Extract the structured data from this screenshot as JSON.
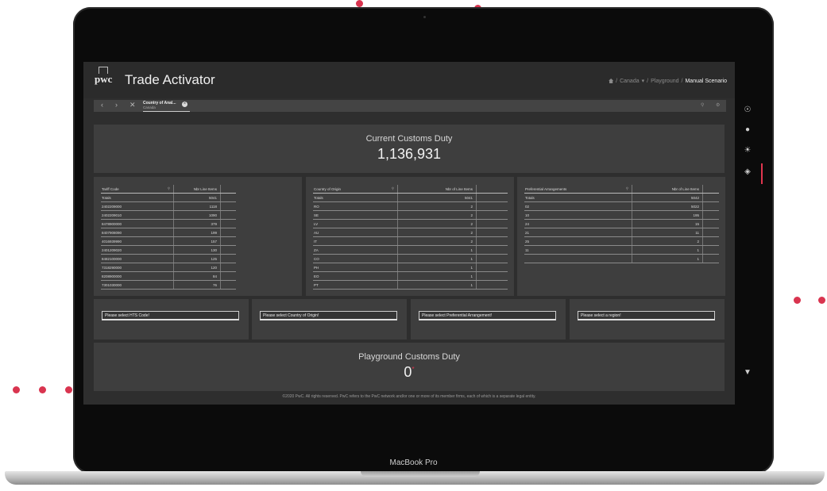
{
  "device": {
    "label": "MacBook Pro"
  },
  "brand": {
    "logo_text": "pwc",
    "accent_color": "#e0364f"
  },
  "app": {
    "title": "Trade Activator"
  },
  "breadcrumb": {
    "items": [
      "Canada",
      "Playground",
      "Manual Scenario"
    ]
  },
  "tabs": [
    {
      "title": "Country of Anal...",
      "subtitle": "Canada"
    }
  ],
  "kpi": {
    "label": "Current Customs Duty",
    "value": "1,136,931"
  },
  "tables": [
    {
      "col1": "Tariff Code",
      "col2": "Nbr Line Items",
      "totals_label": "Totals",
      "totals_value": "5041",
      "rows": [
        [
          "2402209000",
          "1118"
        ],
        [
          "2402209010",
          "1090"
        ],
        [
          "8478900000",
          "379"
        ],
        [
          "8407908090",
          "199"
        ],
        [
          "4016939990",
          "157"
        ],
        [
          "2401209020",
          "130"
        ],
        [
          "8482100000",
          "125"
        ],
        [
          "7318290000",
          "120"
        ],
        [
          "8208900000",
          "84"
        ],
        [
          "7301030000",
          "76"
        ]
      ]
    },
    {
      "col1": "Country of Origin",
      "col2": "Nbr of Line Items",
      "totals_label": "Totals",
      "totals_value": "5041",
      "rows": [
        [
          "RO",
          "2"
        ],
        [
          "SE",
          "2"
        ],
        [
          "LV",
          "2"
        ],
        [
          "AU",
          "2"
        ],
        [
          "IT",
          "2"
        ],
        [
          "ZA",
          "1"
        ],
        [
          "CO",
          "1"
        ],
        [
          "PH",
          "1"
        ],
        [
          "EO",
          "1"
        ],
        [
          "PT",
          "1"
        ]
      ]
    },
    {
      "col1": "Preferential Arrangements",
      "col2": "Nbr of Line Items",
      "totals_label": "Totals",
      "totals_value": "5042",
      "rows": [
        [
          "02",
          "5022"
        ],
        [
          "10",
          "195"
        ],
        [
          "24",
          "15"
        ],
        [
          "21",
          "11"
        ],
        [
          "25",
          "2"
        ],
        [
          "11",
          "1"
        ],
        [
          "",
          "1"
        ]
      ]
    }
  ],
  "selects": [
    {
      "placeholder": "Please select HTS Code!"
    },
    {
      "placeholder": "Please select Country of Origin!"
    },
    {
      "placeholder": "Please select Preferential Arrangement!"
    },
    {
      "placeholder": "Please select a region!"
    }
  ],
  "playground": {
    "label": "Playground Customs Duty",
    "value": "0",
    "marker": "*"
  },
  "footer": {
    "text": "©2020 PwC. All rights reserved. PwC refers to the PwC network and/or one or more of its member firms, each of which is a separate legal entity."
  }
}
